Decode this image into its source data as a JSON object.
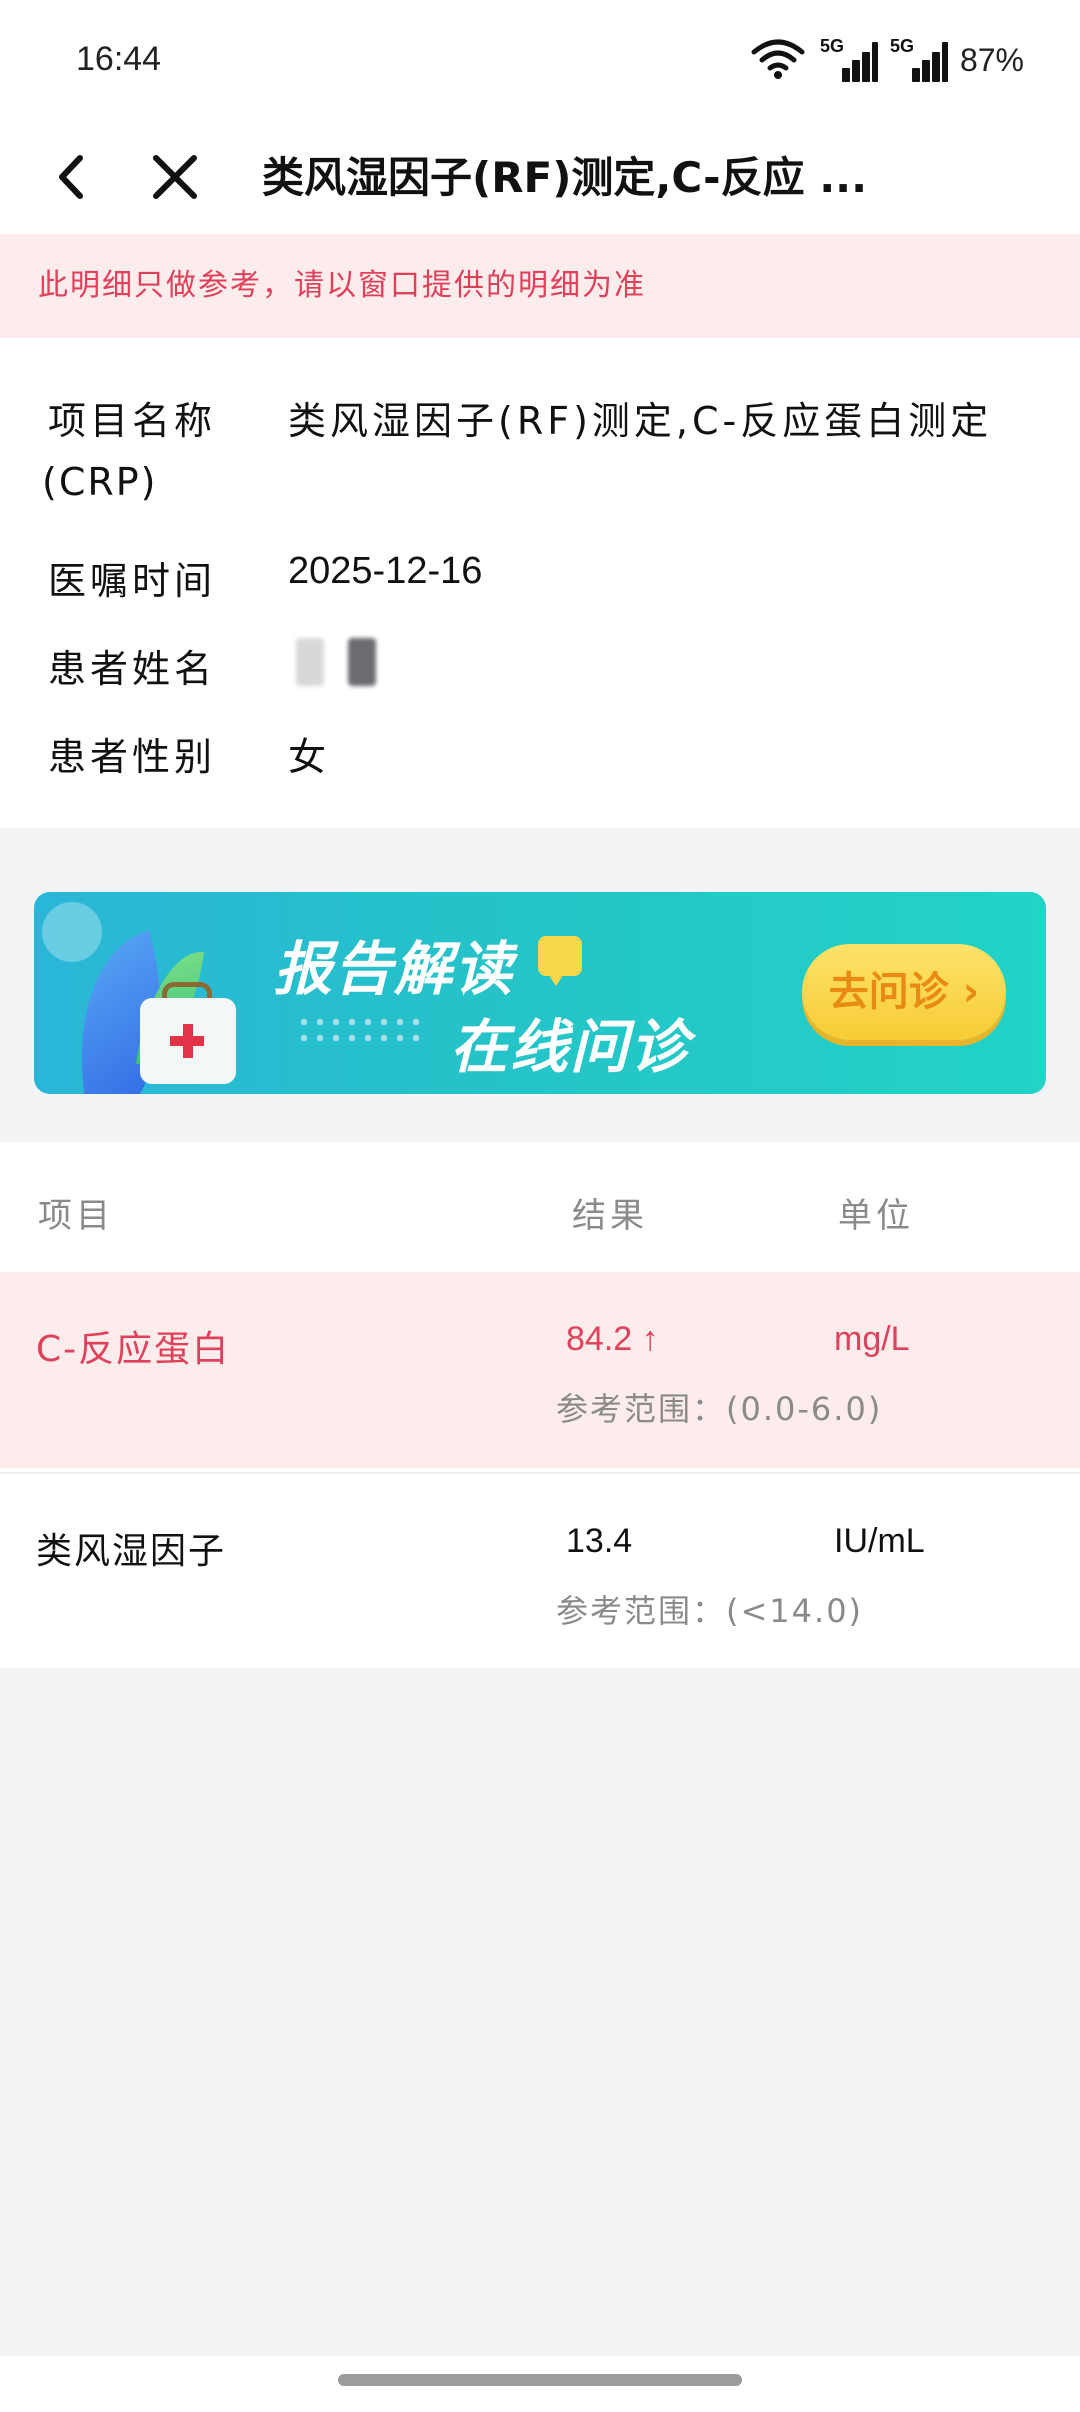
{
  "status_bar": {
    "time": "16:44",
    "signal1_label": "5G",
    "signal2_label": "5G",
    "battery": "87%"
  },
  "nav": {
    "title": "类风湿因子(RF)测定,C-反应 ..."
  },
  "notice": "此明细只做参考，请以窗口提供的明细为准",
  "info": {
    "item_label": "项目名称",
    "item_value": "类风湿因子(RF)测定,C-反应蛋白测定",
    "item_value_wrap": "(CRP)",
    "time_label": "医嘱时间",
    "time_value": "2025-12-16",
    "name_label": "患者姓名",
    "gender_label": "患者性别",
    "gender_value": "女"
  },
  "banner": {
    "title1": "报告解读",
    "title2": "在线问诊",
    "button": "去问诊 ›"
  },
  "results": {
    "headers": {
      "item": "项目",
      "result": "结果",
      "unit": "单位"
    },
    "rows": [
      {
        "name": "C-反应蛋白",
        "value": "84.2 ↑",
        "unit": "mg/L",
        "reference": "参考范围：(0.0-6.0)",
        "abnormal": true
      },
      {
        "name": "类风湿因子",
        "value": "13.4",
        "unit": "IU/mL",
        "reference": "参考范围：(<14.0)",
        "abnormal": false
      }
    ]
  },
  "colors": {
    "alert_red": "#e0405a",
    "alert_bg": "#fdecec",
    "banner_teal": "#22d3c6",
    "button_yellow": "#f7cc35"
  }
}
